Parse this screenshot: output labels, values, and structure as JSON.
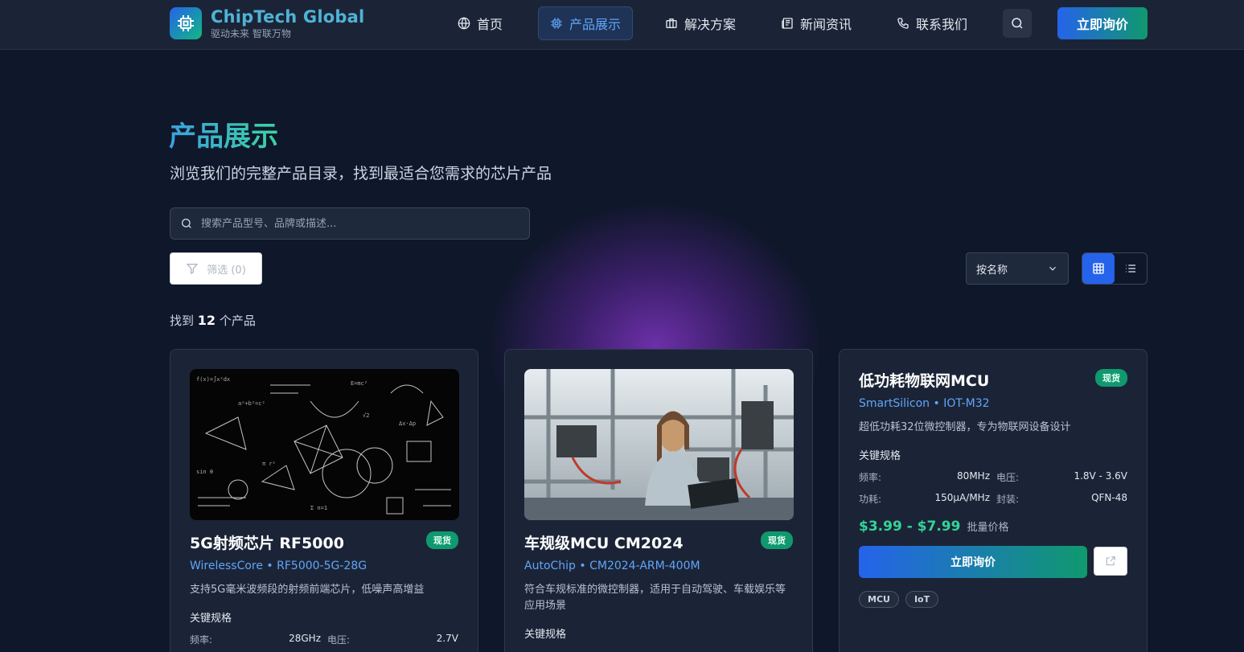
{
  "header": {
    "brand_name": "ChipTech Global",
    "brand_tagline": "驱动未来 智联万物",
    "nav": [
      {
        "label": "首页",
        "icon": "globe-icon",
        "active": false
      },
      {
        "label": "产品展示",
        "icon": "chip-icon",
        "active": true
      },
      {
        "label": "解决方案",
        "icon": "briefcase-icon",
        "active": false
      },
      {
        "label": "新闻资讯",
        "icon": "newspaper-icon",
        "active": false
      },
      {
        "label": "联系我们",
        "icon": "phone-icon",
        "active": false
      }
    ],
    "cta_label": "立即询价"
  },
  "page": {
    "title": "产品展示",
    "subtitle": "浏览我们的完整产品目录，找到最适合您需求的芯片产品"
  },
  "controls": {
    "search_placeholder": "搜索产品型号、品牌或描述...",
    "filter_label": "筛选 (0)",
    "sort_value": "按名称",
    "view_mode": "grid"
  },
  "results": {
    "prefix": "找到",
    "count": "12",
    "suffix": "个产品"
  },
  "products": [
    {
      "name": "5G射频芯片 RF5000",
      "status": "现货",
      "brand_line": "WirelessCore • RF5000-5G-28G",
      "description": "支持5G毫米波频段的射频前端芯片，低噪声高增益",
      "spec_heading": "关键规格",
      "specs": [
        {
          "k": "频率:",
          "v": "28GHz"
        },
        {
          "k": "电压:",
          "v": "2.7V"
        }
      ]
    },
    {
      "name": "车规级MCU CM2024",
      "status": "现货",
      "brand_line": "AutoChip • CM2024-ARM-400M",
      "description": "符合车规标准的微控制器，适用于自动驾驶、车载娱乐等应用场景",
      "spec_heading": "关键规格"
    },
    {
      "name": "低功耗物联网MCU",
      "status": "现货",
      "brand_line": "SmartSilicon • IOT-M32",
      "description": "超低功耗32位微控制器，专为物联网设备设计",
      "spec_heading": "关键规格",
      "specs": [
        {
          "k": "频率:",
          "v": "80MHz"
        },
        {
          "k": "电压:",
          "v": "1.8V - 3.6V"
        },
        {
          "k": "功耗:",
          "v": "150μA/MHz"
        },
        {
          "k": "封装:",
          "v": "QFN-48"
        }
      ],
      "price": "$3.99 - $7.99",
      "price_note": "批量价格",
      "quote_label": "立即询价",
      "tags": [
        "MCU",
        "IoT"
      ]
    }
  ],
  "colors": {
    "background": "#0f172a",
    "accent_blue": "#2563eb",
    "accent_green": "#10996e",
    "price_green": "#34d399",
    "link_blue": "#60a5fa"
  }
}
